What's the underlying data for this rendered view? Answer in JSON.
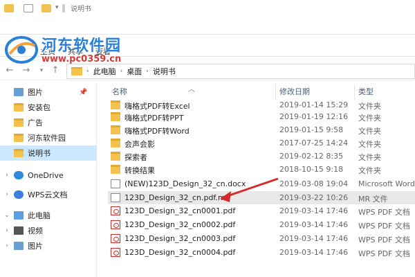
{
  "window": {
    "title": "说明书",
    "ribbon_tabs": [
      "主页",
      "共享",
      "查看"
    ]
  },
  "watermark": {
    "name": "河东软件园",
    "url": "www.pc0359.cn"
  },
  "address_bar": {
    "crumbs": [
      "此电脑",
      "桌面",
      "说明书"
    ]
  },
  "sidebar": {
    "items": [
      {
        "label": "图片",
        "icon": "pictures-icon"
      },
      {
        "label": "安装包",
        "icon": "folder-icon"
      },
      {
        "label": "广告",
        "icon": "folder-icon"
      },
      {
        "label": "河东软件园",
        "icon": "folder-icon"
      },
      {
        "label": "说明书",
        "icon": "folder-icon",
        "selected": true
      },
      {
        "label": "OneDrive",
        "icon": "cloud-icon"
      },
      {
        "label": "WPS云文档",
        "icon": "wps-cloud-icon"
      },
      {
        "label": "此电脑",
        "icon": "computer-icon"
      },
      {
        "label": "视频",
        "icon": "video-icon"
      },
      {
        "label": "图片",
        "icon": "pictures-icon"
      }
    ]
  },
  "file_list": {
    "columns": [
      "名称",
      "修改日期",
      "类型"
    ],
    "rows": [
      {
        "name": "嗨格式PDF转Excel",
        "date": "2019-01-14 15:29",
        "type": "文件夹",
        "icon": "folder"
      },
      {
        "name": "嗨格式PDF转PPT",
        "date": "2019-01-19 12:16",
        "type": "文件夹",
        "icon": "folder"
      },
      {
        "name": "嗨格式PDF转Word",
        "date": "2019-01-15 9:58",
        "type": "文件夹",
        "icon": "folder"
      },
      {
        "name": "会声会影",
        "date": "2017-07-25 14:24",
        "type": "文件夹",
        "icon": "folder"
      },
      {
        "name": "探索者",
        "date": "2019-02-12 8:35",
        "type": "文件夹",
        "icon": "folder"
      },
      {
        "name": "转换结果",
        "date": "2018-10-15 9:18",
        "type": "文件夹",
        "icon": "folder"
      },
      {
        "name": "(NEW)123D_Design_32_cn.docx",
        "date": "2019-03-08 19:04",
        "type": "Microsoft Word",
        "icon": "doc"
      },
      {
        "name": "123D_Design_32_cn.pdf.mr",
        "date": "2019-03-22 10:26",
        "type": "MR 文件",
        "icon": "doc",
        "highlight": true
      },
      {
        "name": "123D_Design_32_cn0001.pdf",
        "date": "2019-03-14 17:46",
        "type": "WPS PDF 文档",
        "icon": "pdf"
      },
      {
        "name": "123D_Design_32_cn0002.pdf",
        "date": "2019-03-14 17:46",
        "type": "WPS PDF 文档",
        "icon": "pdf"
      },
      {
        "name": "123D_Design_32_cn0003.pdf",
        "date": "2019-03-14 17:46",
        "type": "WPS PDF 文档",
        "icon": "pdf"
      },
      {
        "name": "123D_Design_32_cn0004.pdf",
        "date": "2019-03-14 17:46",
        "type": "WPS PDF 文档",
        "icon": "pdf"
      }
    ]
  },
  "colors": {
    "selection": "#cce8ff",
    "highlight_row": "#e8e8e8",
    "annotation_arrow": "#d62b2b",
    "folder": "#f2c14e",
    "watermark_blue": "#2a7fd6",
    "watermark_red": "#d53a3a"
  }
}
